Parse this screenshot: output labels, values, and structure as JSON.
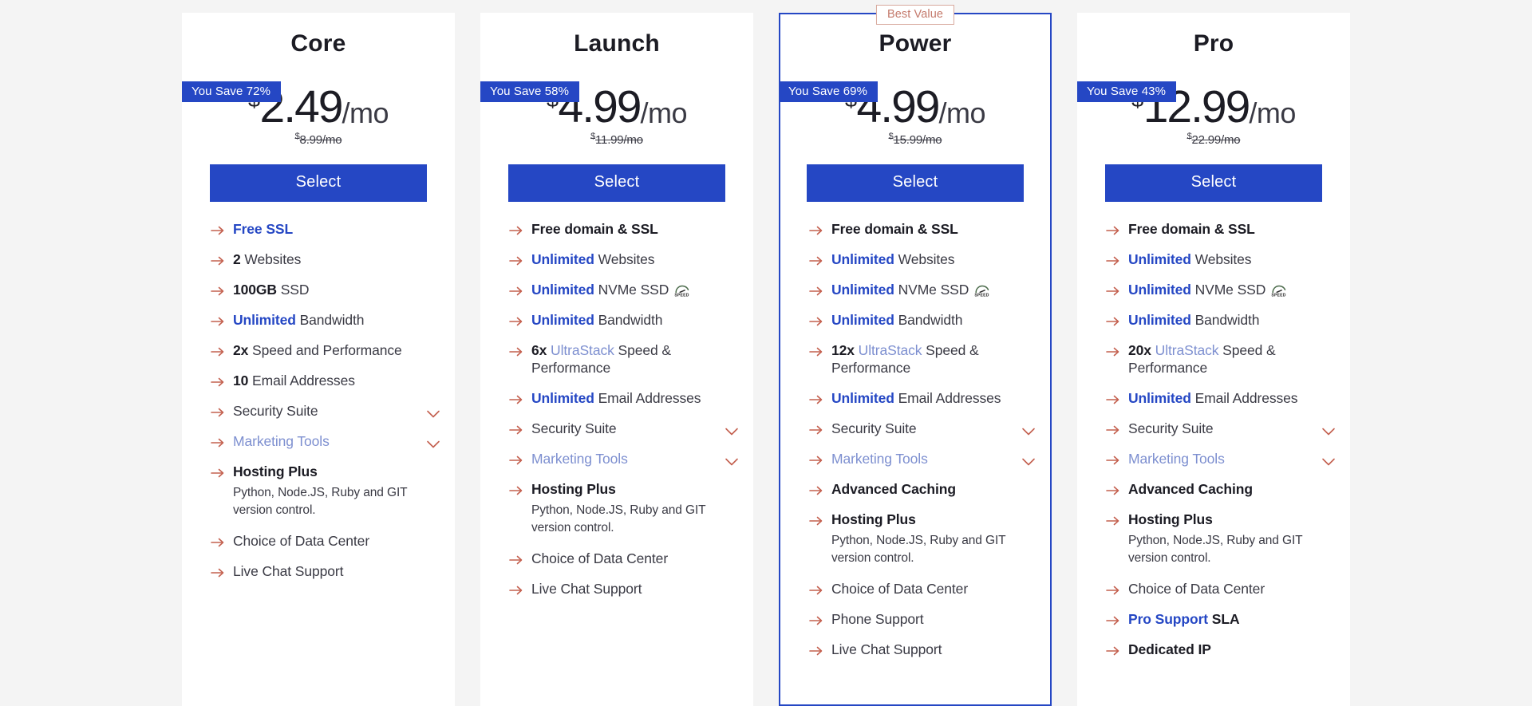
{
  "page": {
    "background": "#f4f4f4",
    "accent_blue": "#2547c4",
    "light_blue": "#7d8fd0",
    "arrow_color": "#c4604f",
    "badge_border": "#d8a99d",
    "select_label": "Select",
    "best_value_label": "Best Value",
    "currency_symbol": "$",
    "per_month": "/mo",
    "speed_icon_label": "SPEED"
  },
  "plans": [
    {
      "name": "Core",
      "save_badge": "You Save 72%",
      "price": "2.49",
      "old_price": "8.99/mo",
      "featured": false,
      "select_label": "Select",
      "features": [
        {
          "icon": "arrow-right-icon",
          "parts": [
            {
              "text": "Free SSL",
              "style": "blue"
            }
          ]
        },
        {
          "icon": "arrow-right-icon",
          "parts": [
            {
              "text": "2",
              "style": "b"
            },
            {
              "text": " Websites",
              "style": "normal"
            }
          ]
        },
        {
          "icon": "arrow-right-icon",
          "parts": [
            {
              "text": "100GB",
              "style": "b"
            },
            {
              "text": " SSD",
              "style": "normal"
            }
          ]
        },
        {
          "icon": "arrow-right-icon",
          "parts": [
            {
              "text": "Unlimited",
              "style": "blue"
            },
            {
              "text": " Bandwidth",
              "style": "normal"
            }
          ]
        },
        {
          "icon": "arrow-right-icon",
          "parts": [
            {
              "text": "2x",
              "style": "b"
            },
            {
              "text": " Speed and Performance",
              "style": "normal"
            }
          ]
        },
        {
          "icon": "arrow-right-icon",
          "parts": [
            {
              "text": "10",
              "style": "b"
            },
            {
              "text": " Email Addresses",
              "style": "normal"
            }
          ]
        },
        {
          "icon": "arrow-right-icon",
          "parts": [
            {
              "text": "Security Suite",
              "style": "normal"
            }
          ],
          "chevron": true
        },
        {
          "icon": "arrow-right-icon",
          "parts": [
            {
              "text": "Marketing Tools",
              "style": "mk"
            }
          ],
          "chevron": true
        },
        {
          "icon": "arrow-right-icon",
          "parts": [
            {
              "text": "Hosting Plus",
              "style": "b"
            }
          ],
          "sub": "Python,  Node.JS,  Ruby and GIT version control."
        },
        {
          "icon": "arrow-right-icon",
          "parts": [
            {
              "text": "Choice of Data Center",
              "style": "normal"
            }
          ]
        },
        {
          "icon": "arrow-right-icon",
          "parts": [
            {
              "text": "Live Chat Support",
              "style": "normal"
            }
          ]
        }
      ]
    },
    {
      "name": "Launch",
      "save_badge": "You Save 58%",
      "price": "4.99",
      "old_price": "11.99/mo",
      "featured": false,
      "select_label": "Select",
      "features": [
        {
          "icon": "arrow-right-icon",
          "parts": [
            {
              "text": "Free domain & SSL",
              "style": "b"
            }
          ]
        },
        {
          "icon": "arrow-right-icon",
          "parts": [
            {
              "text": "Unlimited",
              "style": "blue"
            },
            {
              "text": " Websites",
              "style": "normal"
            }
          ]
        },
        {
          "icon": "arrow-right-icon",
          "parts": [
            {
              "text": "Unlimited",
              "style": "blue"
            },
            {
              "text": " NVMe SSD",
              "style": "normal"
            }
          ],
          "speed_icon": true
        },
        {
          "icon": "arrow-right-icon",
          "parts": [
            {
              "text": "Unlimited",
              "style": "blue"
            },
            {
              "text": " Bandwidth",
              "style": "normal"
            }
          ]
        },
        {
          "icon": "arrow-right-icon",
          "parts": [
            {
              "text": "6x",
              "style": "b"
            },
            {
              "text": " ",
              "style": "normal"
            },
            {
              "text": "UltraStack",
              "style": "lightblue"
            },
            {
              "text": " Speed & Performance",
              "style": "normal"
            }
          ]
        },
        {
          "icon": "arrow-right-icon",
          "parts": [
            {
              "text": "Unlimited",
              "style": "blue"
            },
            {
              "text": " Email Addresses",
              "style": "normal"
            }
          ]
        },
        {
          "icon": "arrow-right-icon",
          "parts": [
            {
              "text": "Security Suite",
              "style": "normal"
            }
          ],
          "chevron": true
        },
        {
          "icon": "arrow-right-icon",
          "parts": [
            {
              "text": "Marketing Tools",
              "style": "mk"
            }
          ],
          "chevron": true
        },
        {
          "icon": "arrow-right-icon",
          "parts": [
            {
              "text": "Hosting Plus",
              "style": "b"
            }
          ],
          "sub": "Python,  Node.JS,  Ruby and GIT version control."
        },
        {
          "icon": "arrow-right-icon",
          "parts": [
            {
              "text": "Choice of Data Center",
              "style": "normal"
            }
          ]
        },
        {
          "icon": "arrow-right-icon",
          "parts": [
            {
              "text": "Live Chat Support",
              "style": "normal"
            }
          ]
        }
      ]
    },
    {
      "name": "Power",
      "save_badge": "You Save 69%",
      "price": "4.99",
      "old_price": "15.99/mo",
      "featured": true,
      "badge": "Best Value",
      "select_label": "Select",
      "features": [
        {
          "icon": "arrow-right-icon",
          "parts": [
            {
              "text": "Free domain & SSL",
              "style": "b"
            }
          ]
        },
        {
          "icon": "arrow-right-icon",
          "parts": [
            {
              "text": "Unlimited",
              "style": "blue"
            },
            {
              "text": " Websites",
              "style": "normal"
            }
          ]
        },
        {
          "icon": "arrow-right-icon",
          "parts": [
            {
              "text": "Unlimited",
              "style": "blue"
            },
            {
              "text": " NVMe SSD",
              "style": "normal"
            }
          ],
          "speed_icon": true
        },
        {
          "icon": "arrow-right-icon",
          "parts": [
            {
              "text": "Unlimited",
              "style": "blue"
            },
            {
              "text": " Bandwidth",
              "style": "normal"
            }
          ]
        },
        {
          "icon": "arrow-right-icon",
          "parts": [
            {
              "text": "12x",
              "style": "b"
            },
            {
              "text": " ",
              "style": "normal"
            },
            {
              "text": "UltraStack",
              "style": "lightblue"
            },
            {
              "text": " Speed & Performance",
              "style": "normal"
            }
          ]
        },
        {
          "icon": "arrow-right-icon",
          "parts": [
            {
              "text": "Unlimited",
              "style": "blue"
            },
            {
              "text": " Email Addresses",
              "style": "normal"
            }
          ]
        },
        {
          "icon": "arrow-right-icon",
          "parts": [
            {
              "text": "Security Suite",
              "style": "normal"
            }
          ],
          "chevron": true
        },
        {
          "icon": "arrow-right-icon",
          "parts": [
            {
              "text": "Marketing Tools",
              "style": "mk"
            }
          ],
          "chevron": true
        },
        {
          "icon": "arrow-right-icon",
          "parts": [
            {
              "text": "Advanced Caching",
              "style": "b"
            }
          ]
        },
        {
          "icon": "arrow-right-icon",
          "parts": [
            {
              "text": "Hosting Plus",
              "style": "b"
            }
          ],
          "sub": "Python,  Node.JS,  Ruby and GIT version control."
        },
        {
          "icon": "arrow-right-icon",
          "parts": [
            {
              "text": "Choice of Data Center",
              "style": "normal"
            }
          ]
        },
        {
          "icon": "arrow-right-icon",
          "parts": [
            {
              "text": "Phone Support",
              "style": "normal"
            }
          ]
        },
        {
          "icon": "arrow-right-icon",
          "parts": [
            {
              "text": "Live Chat Support",
              "style": "normal"
            }
          ]
        }
      ]
    },
    {
      "name": "Pro",
      "save_badge": "You Save 43%",
      "price": "12.99",
      "old_price": "22.99/mo",
      "featured": false,
      "select_label": "Select",
      "features": [
        {
          "icon": "arrow-right-icon",
          "parts": [
            {
              "text": "Free domain & SSL",
              "style": "b"
            }
          ]
        },
        {
          "icon": "arrow-right-icon",
          "parts": [
            {
              "text": "Unlimited",
              "style": "blue"
            },
            {
              "text": " Websites",
              "style": "normal"
            }
          ]
        },
        {
          "icon": "arrow-right-icon",
          "parts": [
            {
              "text": "Unlimited",
              "style": "blue"
            },
            {
              "text": " NVMe SSD",
              "style": "normal"
            }
          ],
          "speed_icon": true
        },
        {
          "icon": "arrow-right-icon",
          "parts": [
            {
              "text": "Unlimited",
              "style": "blue"
            },
            {
              "text": " Bandwidth",
              "style": "normal"
            }
          ]
        },
        {
          "icon": "arrow-right-icon",
          "parts": [
            {
              "text": "20x",
              "style": "b"
            },
            {
              "text": " ",
              "style": "normal"
            },
            {
              "text": "UltraStack",
              "style": "lightblue"
            },
            {
              "text": " Speed & Performance",
              "style": "normal"
            }
          ]
        },
        {
          "icon": "arrow-right-icon",
          "parts": [
            {
              "text": "Unlimited",
              "style": "blue"
            },
            {
              "text": " Email Addresses",
              "style": "normal"
            }
          ]
        },
        {
          "icon": "arrow-right-icon",
          "parts": [
            {
              "text": "Security Suite",
              "style": "normal"
            }
          ],
          "chevron": true
        },
        {
          "icon": "arrow-right-icon",
          "parts": [
            {
              "text": "Marketing Tools",
              "style": "mk"
            }
          ],
          "chevron": true
        },
        {
          "icon": "arrow-right-icon",
          "parts": [
            {
              "text": "Advanced Caching",
              "style": "b"
            }
          ]
        },
        {
          "icon": "arrow-right-icon",
          "parts": [
            {
              "text": "Hosting Plus",
              "style": "b"
            }
          ],
          "sub": "Python,  Node.JS,  Ruby and GIT version control."
        },
        {
          "icon": "arrow-right-icon",
          "parts": [
            {
              "text": "Choice of Data Center",
              "style": "normal"
            }
          ]
        },
        {
          "icon": "arrow-right-icon",
          "parts": [
            {
              "text": "Pro Support",
              "style": "blue"
            },
            {
              "text": " SLA",
              "style": "b"
            }
          ]
        },
        {
          "icon": "arrow-right-icon",
          "parts": [
            {
              "text": "Dedicated IP",
              "style": "b"
            }
          ]
        }
      ]
    }
  ]
}
